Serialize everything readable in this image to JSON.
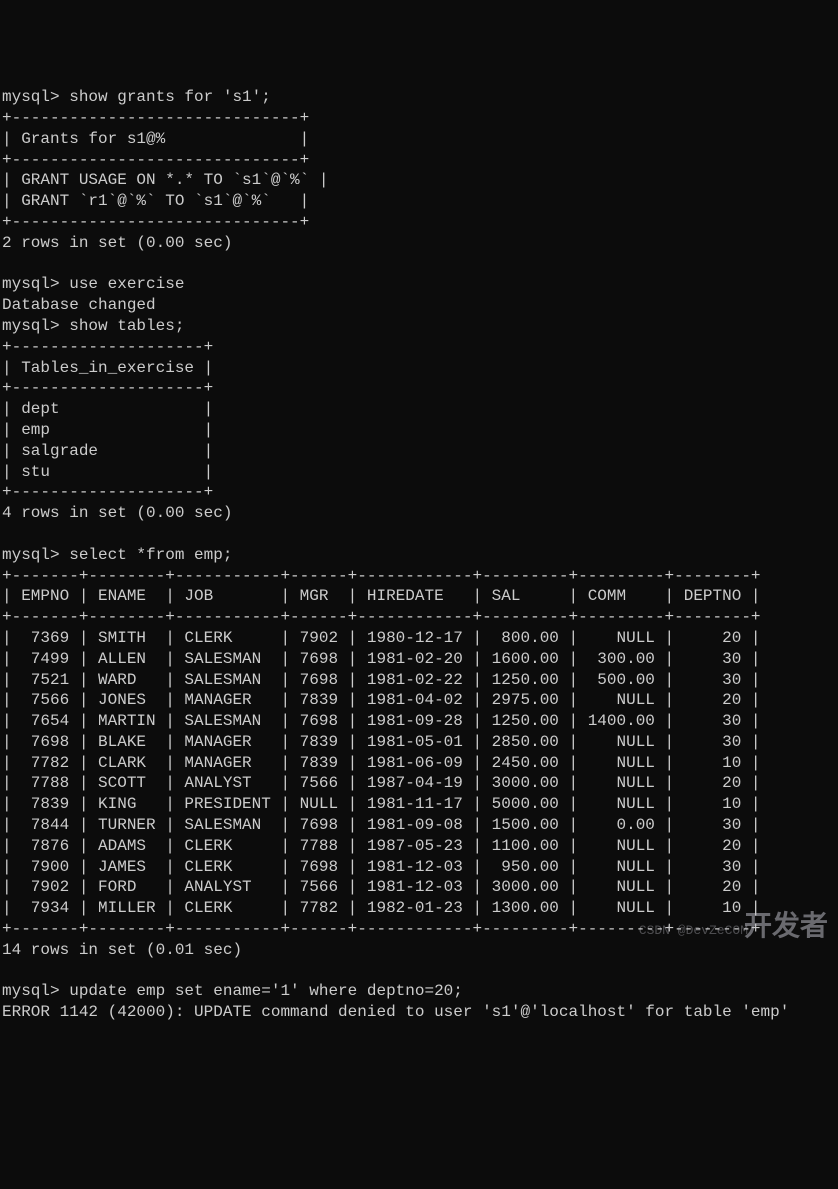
{
  "prompt": "mysql>",
  "cmd_show_grants": "show grants for 's1';",
  "grants_header": "Grants for s1@%",
  "grants_rows": [
    "GRANT USAGE ON *.* TO `s1`@`%`",
    "GRANT `r1`@`%` TO `s1`@`%`"
  ],
  "grants_result": "2 rows in set (0.00 sec)",
  "cmd_use": "use exercise",
  "db_changed": "Database changed",
  "cmd_show_tables": "show tables;",
  "tables_header": "Tables_in_exercise",
  "tables_rows": [
    "dept",
    "emp",
    "salgrade",
    "stu"
  ],
  "tables_result": "4 rows in set (0.00 sec)",
  "cmd_select": "select *from emp;",
  "emp_headers": [
    "EMPNO",
    "ENAME",
    "JOB",
    "MGR",
    "HIREDATE",
    "SAL",
    "COMM",
    "DEPTNO"
  ],
  "emp_rows": [
    {
      "empno": "7369",
      "ename": "SMITH",
      "job": "CLERK",
      "mgr": "7902",
      "hiredate": "1980-12-17",
      "sal": "800.00",
      "comm": "NULL",
      "deptno": "20"
    },
    {
      "empno": "7499",
      "ename": "ALLEN",
      "job": "SALESMAN",
      "mgr": "7698",
      "hiredate": "1981-02-20",
      "sal": "1600.00",
      "comm": "300.00",
      "deptno": "30"
    },
    {
      "empno": "7521",
      "ename": "WARD",
      "job": "SALESMAN",
      "mgr": "7698",
      "hiredate": "1981-02-22",
      "sal": "1250.00",
      "comm": "500.00",
      "deptno": "30"
    },
    {
      "empno": "7566",
      "ename": "JONES",
      "job": "MANAGER",
      "mgr": "7839",
      "hiredate": "1981-04-02",
      "sal": "2975.00",
      "comm": "NULL",
      "deptno": "20"
    },
    {
      "empno": "7654",
      "ename": "MARTIN",
      "job": "SALESMAN",
      "mgr": "7698",
      "hiredate": "1981-09-28",
      "sal": "1250.00",
      "comm": "1400.00",
      "deptno": "30"
    },
    {
      "empno": "7698",
      "ename": "BLAKE",
      "job": "MANAGER",
      "mgr": "7839",
      "hiredate": "1981-05-01",
      "sal": "2850.00",
      "comm": "NULL",
      "deptno": "30"
    },
    {
      "empno": "7782",
      "ename": "CLARK",
      "job": "MANAGER",
      "mgr": "7839",
      "hiredate": "1981-06-09",
      "sal": "2450.00",
      "comm": "NULL",
      "deptno": "10"
    },
    {
      "empno": "7788",
      "ename": "SCOTT",
      "job": "ANALYST",
      "mgr": "7566",
      "hiredate": "1987-04-19",
      "sal": "3000.00",
      "comm": "NULL",
      "deptno": "20"
    },
    {
      "empno": "7839",
      "ename": "KING",
      "job": "PRESIDENT",
      "mgr": "NULL",
      "hiredate": "1981-11-17",
      "sal": "5000.00",
      "comm": "NULL",
      "deptno": "10"
    },
    {
      "empno": "7844",
      "ename": "TURNER",
      "job": "SALESMAN",
      "mgr": "7698",
      "hiredate": "1981-09-08",
      "sal": "1500.00",
      "comm": "0.00",
      "deptno": "30"
    },
    {
      "empno": "7876",
      "ename": "ADAMS",
      "job": "CLERK",
      "mgr": "7788",
      "hiredate": "1987-05-23",
      "sal": "1100.00",
      "comm": "NULL",
      "deptno": "20"
    },
    {
      "empno": "7900",
      "ename": "JAMES",
      "job": "CLERK",
      "mgr": "7698",
      "hiredate": "1981-12-03",
      "sal": "950.00",
      "comm": "NULL",
      "deptno": "30"
    },
    {
      "empno": "7902",
      "ename": "FORD",
      "job": "ANALYST",
      "mgr": "7566",
      "hiredate": "1981-12-03",
      "sal": "3000.00",
      "comm": "NULL",
      "deptno": "20"
    },
    {
      "empno": "7934",
      "ename": "MILLER",
      "job": "CLERK",
      "mgr": "7782",
      "hiredate": "1982-01-23",
      "sal": "1300.00",
      "comm": "NULL",
      "deptno": "10"
    }
  ],
  "emp_result": "14 rows in set (0.01 sec)",
  "cmd_update": "update emp set ename='1' where deptno=20;",
  "error_msg": "ERROR 1142 (42000): UPDATE command denied to user 's1'@'localhost' for table 'emp'",
  "watermark": "开发者",
  "watermark2": "CSDN @DevZeCOM",
  "g_sep": "+------------------------------+",
  "t_sep": "+--------------------+",
  "e_sep": "+-------+--------+-----------+------+------------+---------+---------+--------+"
}
